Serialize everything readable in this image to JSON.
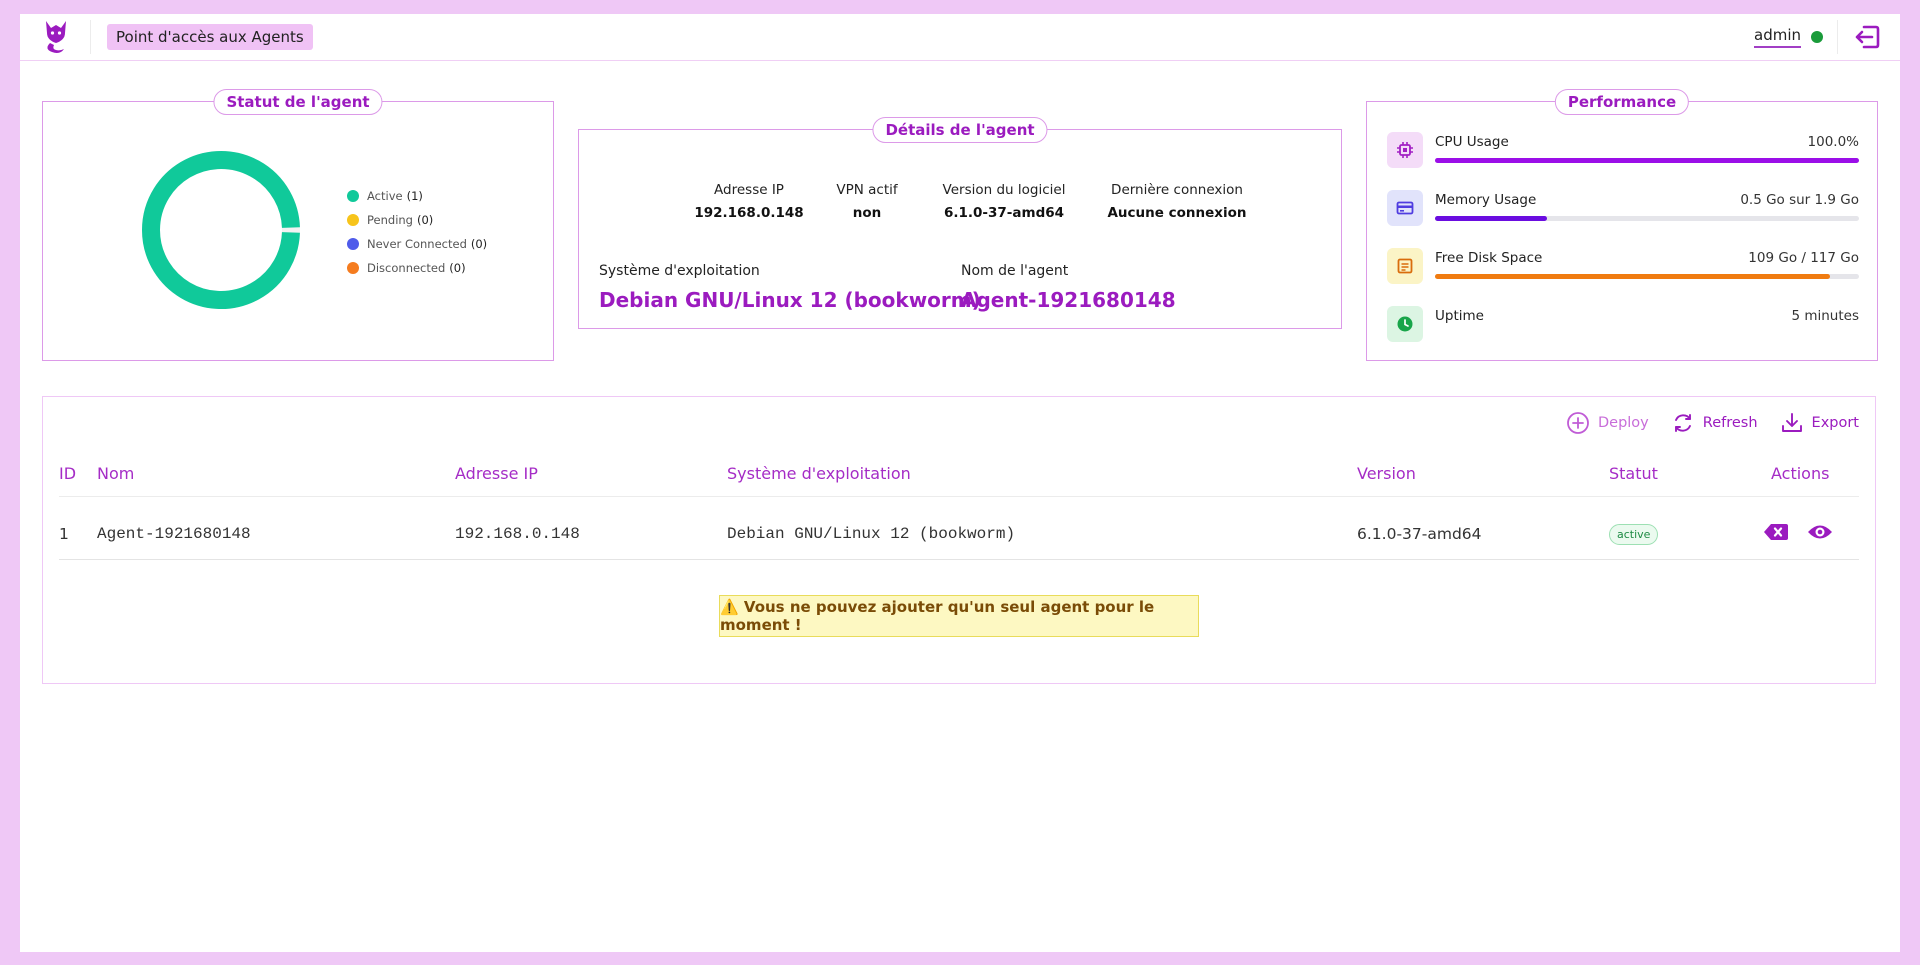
{
  "header": {
    "title": "Point d'accès aux Agents",
    "user": "admin",
    "user_status_color": "#1a9b3a",
    "logo_icon": "fox-logo-icon",
    "logout_icon": "logout-icon"
  },
  "status_card": {
    "title": "Statut de l'agent",
    "legend": [
      {
        "label": "Active",
        "count": "(1)",
        "color": "#10c99a"
      },
      {
        "label": "Pending",
        "count": "(0)",
        "color": "#f7c41b"
      },
      {
        "label": "Never Connected",
        "count": "(0)",
        "color": "#4f5bea"
      },
      {
        "label": "Disconnected",
        "count": "(0)",
        "color": "#f57c1f"
      }
    ]
  },
  "chart_data": {
    "type": "pie",
    "categories": [
      "Active",
      "Pending",
      "Never Connected",
      "Disconnected"
    ],
    "values": [
      1,
      0,
      0,
      0
    ],
    "colors": [
      "#10c99a",
      "#f7c41b",
      "#4f5bea",
      "#f57c1f"
    ],
    "legend": "right"
  },
  "details_card": {
    "title": "Détails de l'agent",
    "ip_label": "Adresse IP",
    "ip_value": "192.168.0.148",
    "vpn_label": "VPN actif",
    "vpn_value": "non",
    "version_label": "Version du logiciel",
    "version_value": "6.1.0-37-amd64",
    "last_label": "Dernière connexion",
    "last_value": "Aucune connexion",
    "os_label": "Système d'exploitation",
    "os_value": "Debian GNU/Linux 12 (bookworm)",
    "name_label": "Nom de l'agent",
    "name_value": "Agent-1921680148"
  },
  "perf_card": {
    "title": "Performance",
    "items": [
      {
        "label": "CPU Usage",
        "value": "100.0%",
        "fraction": 1.0,
        "color": "#9b0ee8",
        "icon": "cpu-icon",
        "icon_bg": "#f4dcf8"
      },
      {
        "label": "Memory Usage",
        "value": "0.5 Go sur 1.9 Go",
        "fraction": 0.263,
        "color": "#6a0de0",
        "icon": "memory-card-icon",
        "icon_bg": "#e1e3fb"
      },
      {
        "label": "Free Disk Space",
        "value": "109 Go / 117 Go",
        "fraction": 0.932,
        "color": "#f07b10",
        "icon": "disk-icon",
        "icon_bg": "#fbf4c6"
      },
      {
        "label": "Uptime",
        "value": "5 minutes",
        "fraction": null,
        "color": "#19a54a",
        "icon": "clock-icon",
        "icon_bg": "#dcf5e3"
      }
    ]
  },
  "table": {
    "actions": {
      "deploy": "Deploy",
      "refresh": "Refresh",
      "export": "Export"
    },
    "headers": [
      "ID",
      "Nom",
      "Adresse IP",
      "Système d'exploitation",
      "Version",
      "Statut",
      "Actions"
    ],
    "rows": [
      {
        "id": "1",
        "name": "Agent-1921680148",
        "ip": "192.168.0.148",
        "os": "Debian GNU/Linux 12 (bookworm)",
        "version": "6.1.0-37-amd64",
        "status": "active"
      }
    ],
    "warning": "⚠️ Vous ne pouvez ajouter qu'un seul agent pour le moment !"
  },
  "accent_color": "#9b1bbf"
}
